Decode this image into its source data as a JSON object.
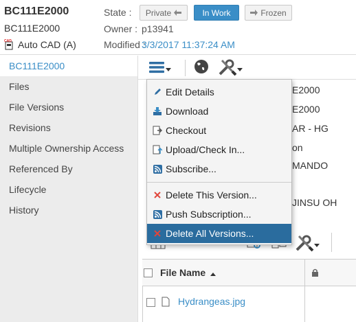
{
  "header": {
    "title": "BC111E2000",
    "subtitle": "BC111E2000",
    "cad_type": "Auto CAD (A)",
    "cad_icon_text": "CAD",
    "state_label": "State :",
    "owner_label": "Owner :",
    "owner_value": "p13941",
    "modified_label": "Modified :",
    "modified_value": "3/3/2017 11:37:24 AM",
    "states": {
      "private": "Private",
      "in_work": "In Work",
      "frozen": "Frozen"
    }
  },
  "sidebar": {
    "items": [
      {
        "label": "BC111E2000"
      },
      {
        "label": "Files"
      },
      {
        "label": "File Versions"
      },
      {
        "label": "Revisions"
      },
      {
        "label": "Multiple Ownership Access"
      },
      {
        "label": "Referenced By"
      },
      {
        "label": "Lifecycle"
      },
      {
        "label": "History"
      }
    ]
  },
  "content": {
    "values": [
      "E2000",
      "E2000",
      "AR - HG",
      "on",
      "MANDO",
      "JINSU OH"
    ],
    "file_table": {
      "col_file_name": "File Name",
      "rows": [
        {
          "name": "Hydrangeas.jpg"
        }
      ]
    }
  },
  "menu": {
    "items": [
      {
        "label": "Edit Details",
        "icon": "pencil-icon"
      },
      {
        "label": "Download",
        "icon": "download-icon"
      },
      {
        "label": "Checkout",
        "icon": "checkout-icon"
      },
      {
        "label": "Upload/Check In...",
        "icon": "upload-icon"
      },
      {
        "label": "Subscribe...",
        "icon": "rss-icon"
      },
      {
        "label": "Delete This Version...",
        "icon": "x-icon"
      },
      {
        "label": "Push Subscription...",
        "icon": "rss-icon"
      },
      {
        "label": "Delete All Versions...",
        "icon": "x-icon"
      }
    ]
  },
  "colors": {
    "accent": "#3a8ec7",
    "highlight": "#2a6c9e",
    "danger": "#e0463b"
  }
}
